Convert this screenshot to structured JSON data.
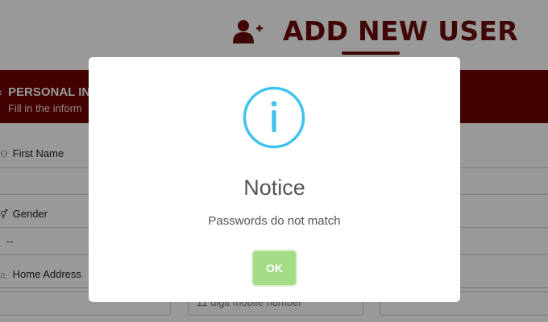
{
  "header": {
    "title": "ADD NEW USER",
    "icon": "add-user-icon"
  },
  "section": {
    "title": "PERSONAL IN",
    "subtitle": "Fill in the inform",
    "chevron": "‹"
  },
  "form": {
    "first_name_label": "First Name",
    "gender_label": "Gender",
    "gender_value": "--",
    "home_address_label": "Home Address",
    "mobile_placeholder": "11 digit mobile number"
  },
  "modal": {
    "icon": "info-icon",
    "title": "Notice",
    "message": "Passwords do not match",
    "ok_label": "OK"
  },
  "colors": {
    "brand": "#6b0a0a",
    "band": "#6e0000",
    "info": "#3fc3ee",
    "ok_button": "#a5dc86"
  }
}
